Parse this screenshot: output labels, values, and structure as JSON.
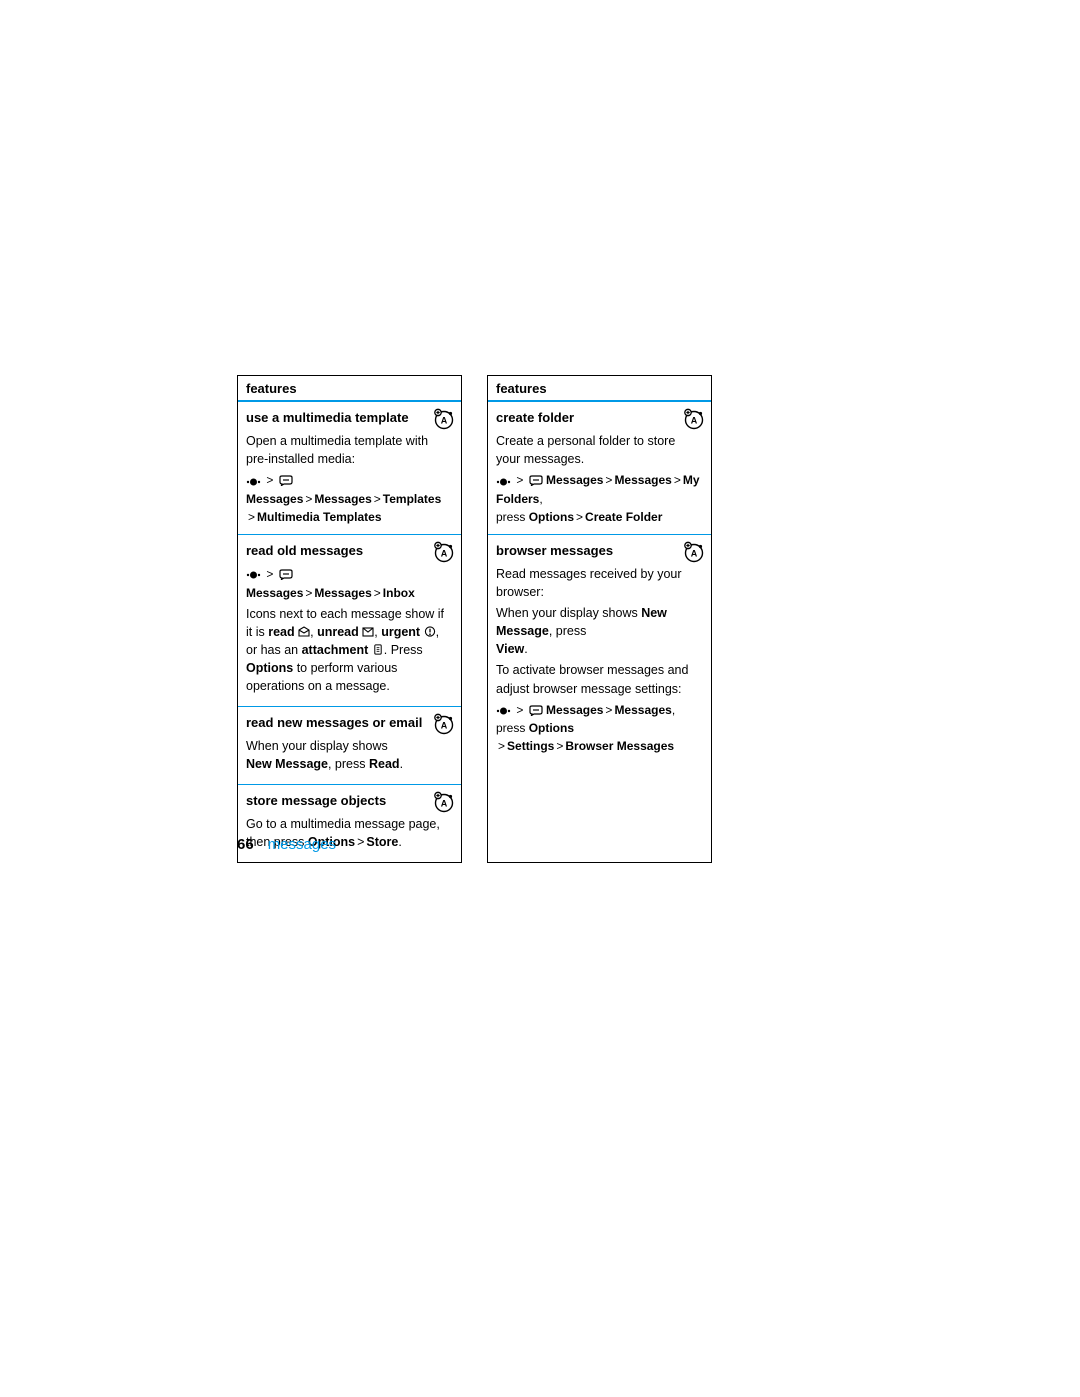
{
  "header": "features",
  "footer": {
    "page": "66",
    "section": "messages"
  },
  "left": {
    "f1": {
      "title": "use a multimedia template",
      "body": "Open a multimedia template with pre-installed media:",
      "nav1a": "Messages",
      "nav1b": "Messages",
      "nav1c": "Templates",
      "nav2": "Multimedia Templates"
    },
    "f2": {
      "title": "read old messages",
      "nav1a": "Messages",
      "nav1b": "Messages",
      "nav1c": "Inbox",
      "body1": "Icons next to each message show if it is ",
      "read": "read",
      "unread": "unread",
      "urgent": "urgent",
      "orhas": ", or has an ",
      "attachment": "attachment",
      "press": ". Press ",
      "options": "Options",
      "rest": " to perform various operations on a message."
    },
    "f3": {
      "title": "read new messages or email",
      "body1": "When your display shows ",
      "newmsg": "New Message",
      "press": ", press ",
      "read": "Read",
      "dot": "."
    },
    "f4": {
      "title": "store message objects",
      "body1": "Go to a multimedia message page, then press ",
      "options": "Options",
      "store": "Store",
      "dot": "."
    }
  },
  "right": {
    "f1": {
      "title": "create folder",
      "body": "Create a personal folder to store your messages.",
      "nav1a": "Messages",
      "nav1b": "Messages",
      "nav1c": "My Folders",
      "press": "press ",
      "options": "Options",
      "create": "Create Folder"
    },
    "f2": {
      "title": "browser messages",
      "body1": "Read messages received by your browser:",
      "body2a": "When your display shows ",
      "newmsg": "New Message",
      "body2b": ", press ",
      "view": "View",
      "body2c": ".",
      "body3": "To activate browser messages and adjust browser message settings:",
      "nav1a": "Messages",
      "nav1b": "Messages",
      "press": ", press ",
      "options": "Options",
      "settings": "Settings",
      "browser": "Browser Messages"
    }
  }
}
